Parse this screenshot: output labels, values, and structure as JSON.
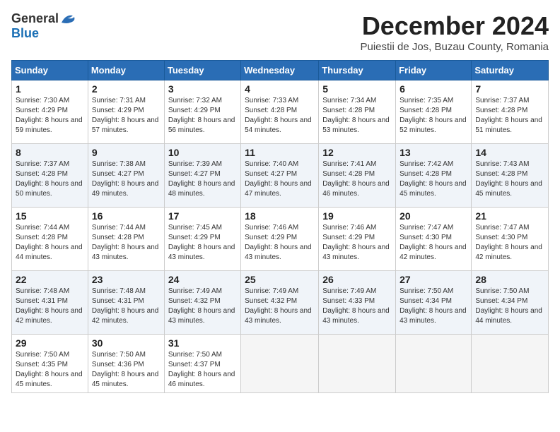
{
  "header": {
    "logo": {
      "general": "General",
      "blue": "Blue"
    },
    "title": "December 2024",
    "subtitle": "Puiestii de Jos, Buzau County, Romania"
  },
  "days_of_week": [
    "Sunday",
    "Monday",
    "Tuesday",
    "Wednesday",
    "Thursday",
    "Friday",
    "Saturday"
  ],
  "weeks": [
    [
      {
        "day": 1,
        "sunrise": "7:30 AM",
        "sunset": "4:29 PM",
        "daylight": "8 hours and 59 minutes."
      },
      {
        "day": 2,
        "sunrise": "7:31 AM",
        "sunset": "4:29 PM",
        "daylight": "8 hours and 57 minutes."
      },
      {
        "day": 3,
        "sunrise": "7:32 AM",
        "sunset": "4:29 PM",
        "daylight": "8 hours and 56 minutes."
      },
      {
        "day": 4,
        "sunrise": "7:33 AM",
        "sunset": "4:28 PM",
        "daylight": "8 hours and 54 minutes."
      },
      {
        "day": 5,
        "sunrise": "7:34 AM",
        "sunset": "4:28 PM",
        "daylight": "8 hours and 53 minutes."
      },
      {
        "day": 6,
        "sunrise": "7:35 AM",
        "sunset": "4:28 PM",
        "daylight": "8 hours and 52 minutes."
      },
      {
        "day": 7,
        "sunrise": "7:37 AM",
        "sunset": "4:28 PM",
        "daylight": "8 hours and 51 minutes."
      }
    ],
    [
      {
        "day": 8,
        "sunrise": "7:37 AM",
        "sunset": "4:28 PM",
        "daylight": "8 hours and 50 minutes."
      },
      {
        "day": 9,
        "sunrise": "7:38 AM",
        "sunset": "4:27 PM",
        "daylight": "8 hours and 49 minutes."
      },
      {
        "day": 10,
        "sunrise": "7:39 AM",
        "sunset": "4:27 PM",
        "daylight": "8 hours and 48 minutes."
      },
      {
        "day": 11,
        "sunrise": "7:40 AM",
        "sunset": "4:27 PM",
        "daylight": "8 hours and 47 minutes."
      },
      {
        "day": 12,
        "sunrise": "7:41 AM",
        "sunset": "4:28 PM",
        "daylight": "8 hours and 46 minutes."
      },
      {
        "day": 13,
        "sunrise": "7:42 AM",
        "sunset": "4:28 PM",
        "daylight": "8 hours and 45 minutes."
      },
      {
        "day": 14,
        "sunrise": "7:43 AM",
        "sunset": "4:28 PM",
        "daylight": "8 hours and 45 minutes."
      }
    ],
    [
      {
        "day": 15,
        "sunrise": "7:44 AM",
        "sunset": "4:28 PM",
        "daylight": "8 hours and 44 minutes."
      },
      {
        "day": 16,
        "sunrise": "7:44 AM",
        "sunset": "4:28 PM",
        "daylight": "8 hours and 43 minutes."
      },
      {
        "day": 17,
        "sunrise": "7:45 AM",
        "sunset": "4:29 PM",
        "daylight": "8 hours and 43 minutes."
      },
      {
        "day": 18,
        "sunrise": "7:46 AM",
        "sunset": "4:29 PM",
        "daylight": "8 hours and 43 minutes."
      },
      {
        "day": 19,
        "sunrise": "7:46 AM",
        "sunset": "4:29 PM",
        "daylight": "8 hours and 43 minutes."
      },
      {
        "day": 20,
        "sunrise": "7:47 AM",
        "sunset": "4:30 PM",
        "daylight": "8 hours and 42 minutes."
      },
      {
        "day": 21,
        "sunrise": "7:47 AM",
        "sunset": "4:30 PM",
        "daylight": "8 hours and 42 minutes."
      }
    ],
    [
      {
        "day": 22,
        "sunrise": "7:48 AM",
        "sunset": "4:31 PM",
        "daylight": "8 hours and 42 minutes."
      },
      {
        "day": 23,
        "sunrise": "7:48 AM",
        "sunset": "4:31 PM",
        "daylight": "8 hours and 42 minutes."
      },
      {
        "day": 24,
        "sunrise": "7:49 AM",
        "sunset": "4:32 PM",
        "daylight": "8 hours and 43 minutes."
      },
      {
        "day": 25,
        "sunrise": "7:49 AM",
        "sunset": "4:32 PM",
        "daylight": "8 hours and 43 minutes."
      },
      {
        "day": 26,
        "sunrise": "7:49 AM",
        "sunset": "4:33 PM",
        "daylight": "8 hours and 43 minutes."
      },
      {
        "day": 27,
        "sunrise": "7:50 AM",
        "sunset": "4:34 PM",
        "daylight": "8 hours and 43 minutes."
      },
      {
        "day": 28,
        "sunrise": "7:50 AM",
        "sunset": "4:34 PM",
        "daylight": "8 hours and 44 minutes."
      }
    ],
    [
      {
        "day": 29,
        "sunrise": "7:50 AM",
        "sunset": "4:35 PM",
        "daylight": "8 hours and 45 minutes."
      },
      {
        "day": 30,
        "sunrise": "7:50 AM",
        "sunset": "4:36 PM",
        "daylight": "8 hours and 45 minutes."
      },
      {
        "day": 31,
        "sunrise": "7:50 AM",
        "sunset": "4:37 PM",
        "daylight": "8 hours and 46 minutes."
      },
      null,
      null,
      null,
      null
    ]
  ],
  "labels": {
    "sunrise": "Sunrise:",
    "sunset": "Sunset:",
    "daylight": "Daylight:"
  }
}
